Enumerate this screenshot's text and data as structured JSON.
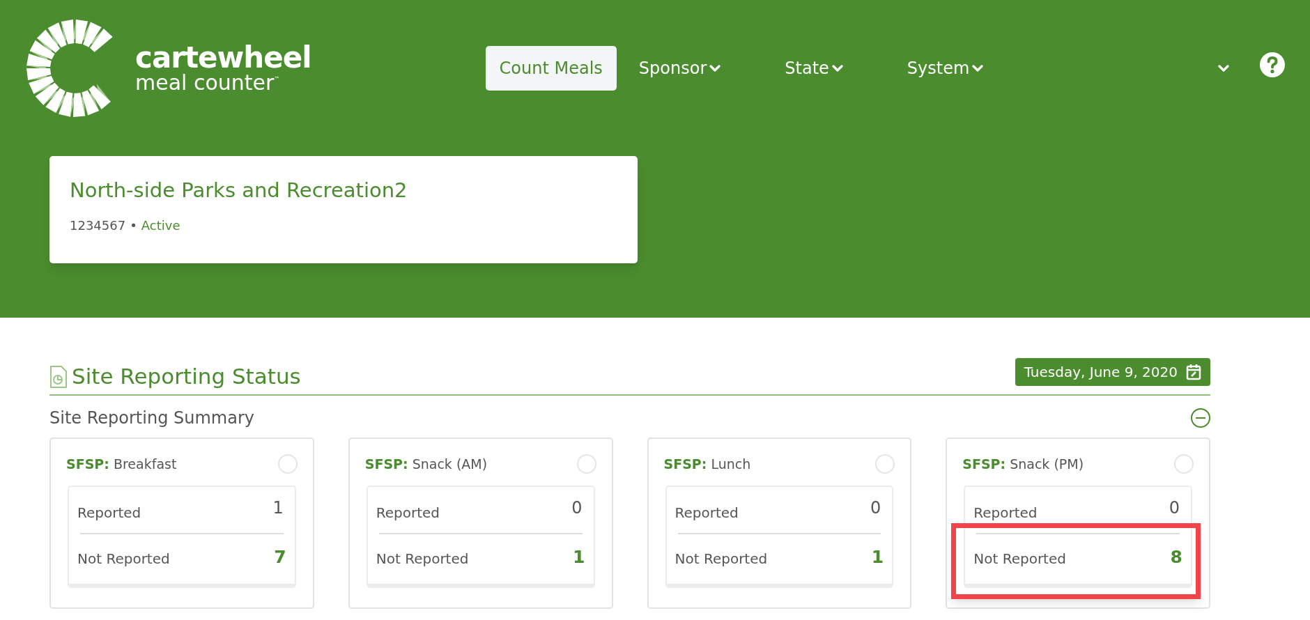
{
  "header": {
    "logo": {
      "name": "cartewheel",
      "tagline": "meal counter",
      "trademark": "™"
    },
    "nav": [
      {
        "label": "Count Meals",
        "selected": true,
        "dropdown": false
      },
      {
        "label": "Sponsor",
        "selected": false,
        "dropdown": true
      },
      {
        "label": "State",
        "selected": false,
        "dropdown": true
      },
      {
        "label": "System",
        "selected": false,
        "dropdown": true
      },
      {
        "kind": "account",
        "selected": false,
        "dropdown": true
      }
    ]
  },
  "site": {
    "name": "North-side Parks and Recreation2",
    "id": "1234567",
    "separator": "•",
    "status": "Active"
  },
  "section": {
    "title": "Site Reporting Status",
    "date": "Tuesday, June 9, 2020",
    "summary_title": "Site Reporting Summary",
    "expanded": true
  },
  "cards": [
    {
      "program": "SFSP:",
      "meal": "Breakfast",
      "checked": false,
      "reported_label": "Reported",
      "reported": "1",
      "not_reported_label": "Not Reported",
      "not_reported": "7",
      "highlighted": false
    },
    {
      "program": "SFSP:",
      "meal": "Snack (AM)",
      "checked": false,
      "reported_label": "Reported",
      "reported": "0",
      "not_reported_label": "Not Reported",
      "not_reported": "1",
      "highlighted": false
    },
    {
      "program": "SFSP:",
      "meal": "Lunch",
      "checked": false,
      "reported_label": "Reported",
      "reported": "0",
      "not_reported_label": "Not Reported",
      "not_reported": "1",
      "highlighted": false
    },
    {
      "program": "SFSP:",
      "meal": "Snack (PM)",
      "checked": false,
      "reported_label": "Reported",
      "reported": "0",
      "not_reported_label": "Not Reported",
      "not_reported": "8",
      "highlighted": true
    }
  ]
}
